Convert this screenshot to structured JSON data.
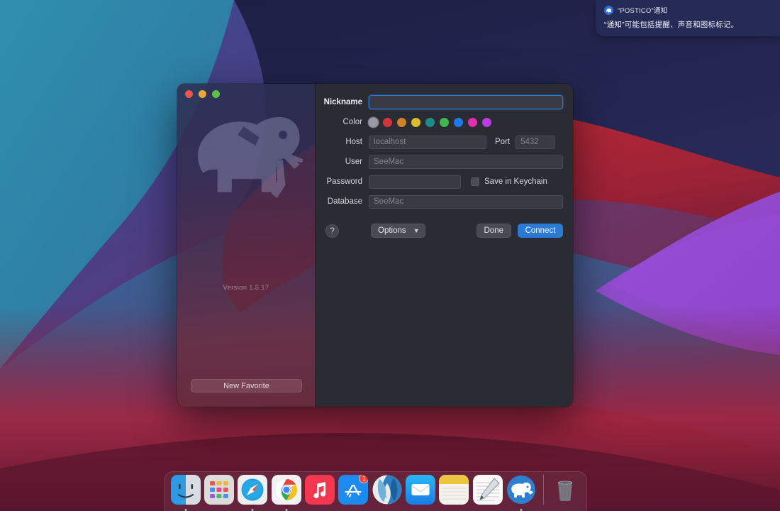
{
  "notification": {
    "app_icon": "postico-elephant-icon",
    "title": "“POSTICO”通知",
    "body": "“通知”可能包括提醒、声音和图标标记。"
  },
  "window": {
    "traffic_lights": [
      "close-red",
      "minimize-yellow",
      "zoom-green"
    ],
    "sidebar": {
      "logo": "elephant-logo",
      "version": "Version 1.5.17",
      "new_favorite_label": "New Favorite"
    },
    "form": {
      "nickname": {
        "label": "Nickname",
        "value": "",
        "placeholder": ""
      },
      "color": {
        "label": "Color",
        "selected_index": 0,
        "swatches": [
          {
            "name": "gray",
            "hex": "#9a9aa2"
          },
          {
            "name": "red",
            "hex": "#d0353c"
          },
          {
            "name": "orange",
            "hex": "#cf8229"
          },
          {
            "name": "yellow",
            "hex": "#dbbc2f"
          },
          {
            "name": "teal",
            "hex": "#1a8d8e"
          },
          {
            "name": "green",
            "hex": "#41b74e"
          },
          {
            "name": "blue",
            "hex": "#1f79e8"
          },
          {
            "name": "pink",
            "hex": "#e22fae"
          },
          {
            "name": "purple",
            "hex": "#b63fdd"
          }
        ]
      },
      "host": {
        "label": "Host",
        "value": "",
        "placeholder": "localhost"
      },
      "port": {
        "label": "Port",
        "value": "",
        "placeholder": "5432"
      },
      "user": {
        "label": "User",
        "value": "",
        "placeholder": "SeeMac"
      },
      "password": {
        "label": "Password",
        "value": "",
        "placeholder": ""
      },
      "keychain": {
        "label": "Save in Keychain",
        "checked": false
      },
      "database": {
        "label": "Database",
        "value": "",
        "placeholder": "SeeMac"
      }
    },
    "buttons": {
      "help": "?",
      "options": "Options",
      "options_chevron": "chevron-down-icon",
      "done": "Done",
      "connect": "Connect",
      "connect_color": "#2a79d4"
    }
  },
  "dock": {
    "items": [
      {
        "name": "finder",
        "label": "Finder",
        "running": true,
        "badge": ""
      },
      {
        "name": "launchpad",
        "label": "Launchpad",
        "running": false,
        "badge": ""
      },
      {
        "name": "safari",
        "label": "Safari",
        "running": true,
        "badge": ""
      },
      {
        "name": "chrome",
        "label": "Google Chrome",
        "running": true,
        "badge": ""
      },
      {
        "name": "music",
        "label": "Music",
        "running": false,
        "badge": ""
      },
      {
        "name": "app-store",
        "label": "App Store",
        "running": false,
        "badge": "1"
      },
      {
        "name": "siri",
        "label": "Siri",
        "running": false,
        "badge": ""
      },
      {
        "name": "mail",
        "label": "Mail",
        "running": false,
        "badge": ""
      },
      {
        "name": "notes",
        "label": "Notes",
        "running": false,
        "badge": ""
      },
      {
        "name": "textedit",
        "label": "TextEdit",
        "running": false,
        "badge": ""
      },
      {
        "name": "postico",
        "label": "Postico",
        "running": true,
        "badge": ""
      },
      {
        "name": "trash",
        "label": "Trash",
        "running": false,
        "badge": ""
      }
    ]
  }
}
